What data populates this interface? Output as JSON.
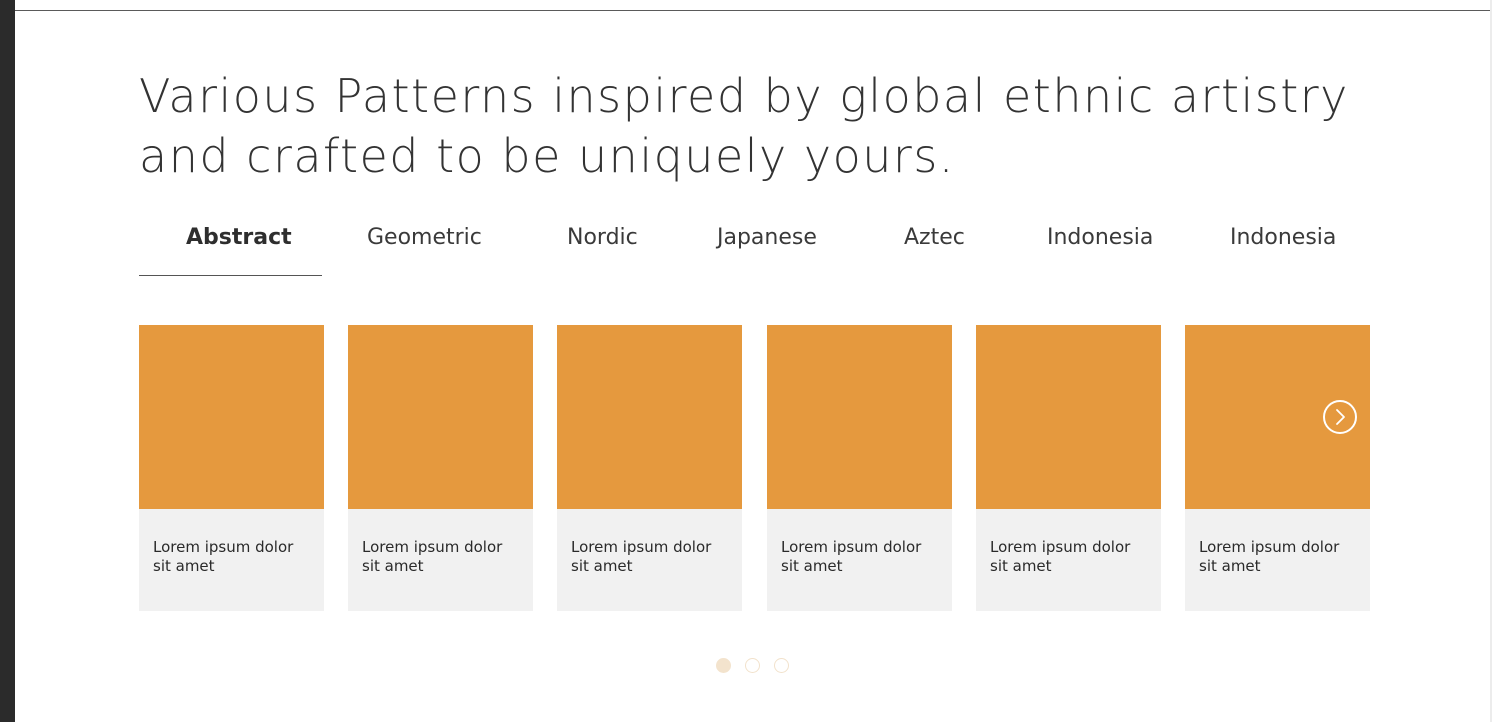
{
  "headline": {
    "line1": "Various Patterns inspired by global ethnic artistry",
    "line2": "and crafted to be uniquely yours."
  },
  "tabs": [
    {
      "label": "Abstract",
      "active": true
    },
    {
      "label": "Geometric",
      "active": false
    },
    {
      "label": "Nordic",
      "active": false
    },
    {
      "label": "Japanese",
      "active": false
    },
    {
      "label": "Aztec",
      "active": false
    },
    {
      "label": "Indonesia",
      "active": false
    },
    {
      "label": "Indonesia",
      "active": false
    }
  ],
  "cards": [
    {
      "caption": "Lorem ipsum dolor sit amet"
    },
    {
      "caption": "Lorem ipsum dolor sit amet"
    },
    {
      "caption": "Lorem ipsum dolor sit amet"
    },
    {
      "caption": "Lorem ipsum dolor sit amet"
    },
    {
      "caption": "Lorem ipsum dolor sit amet"
    },
    {
      "caption": "Lorem ipsum dolor sit amet"
    }
  ],
  "carousel": {
    "next_icon": "chevron-right-circle-icon",
    "pages": 3,
    "current_page": 1
  },
  "colors": {
    "card_image": "#e5993e",
    "card_body": "#f1f1f1",
    "dot_active": "#f3e3cd",
    "text": "#333333"
  }
}
